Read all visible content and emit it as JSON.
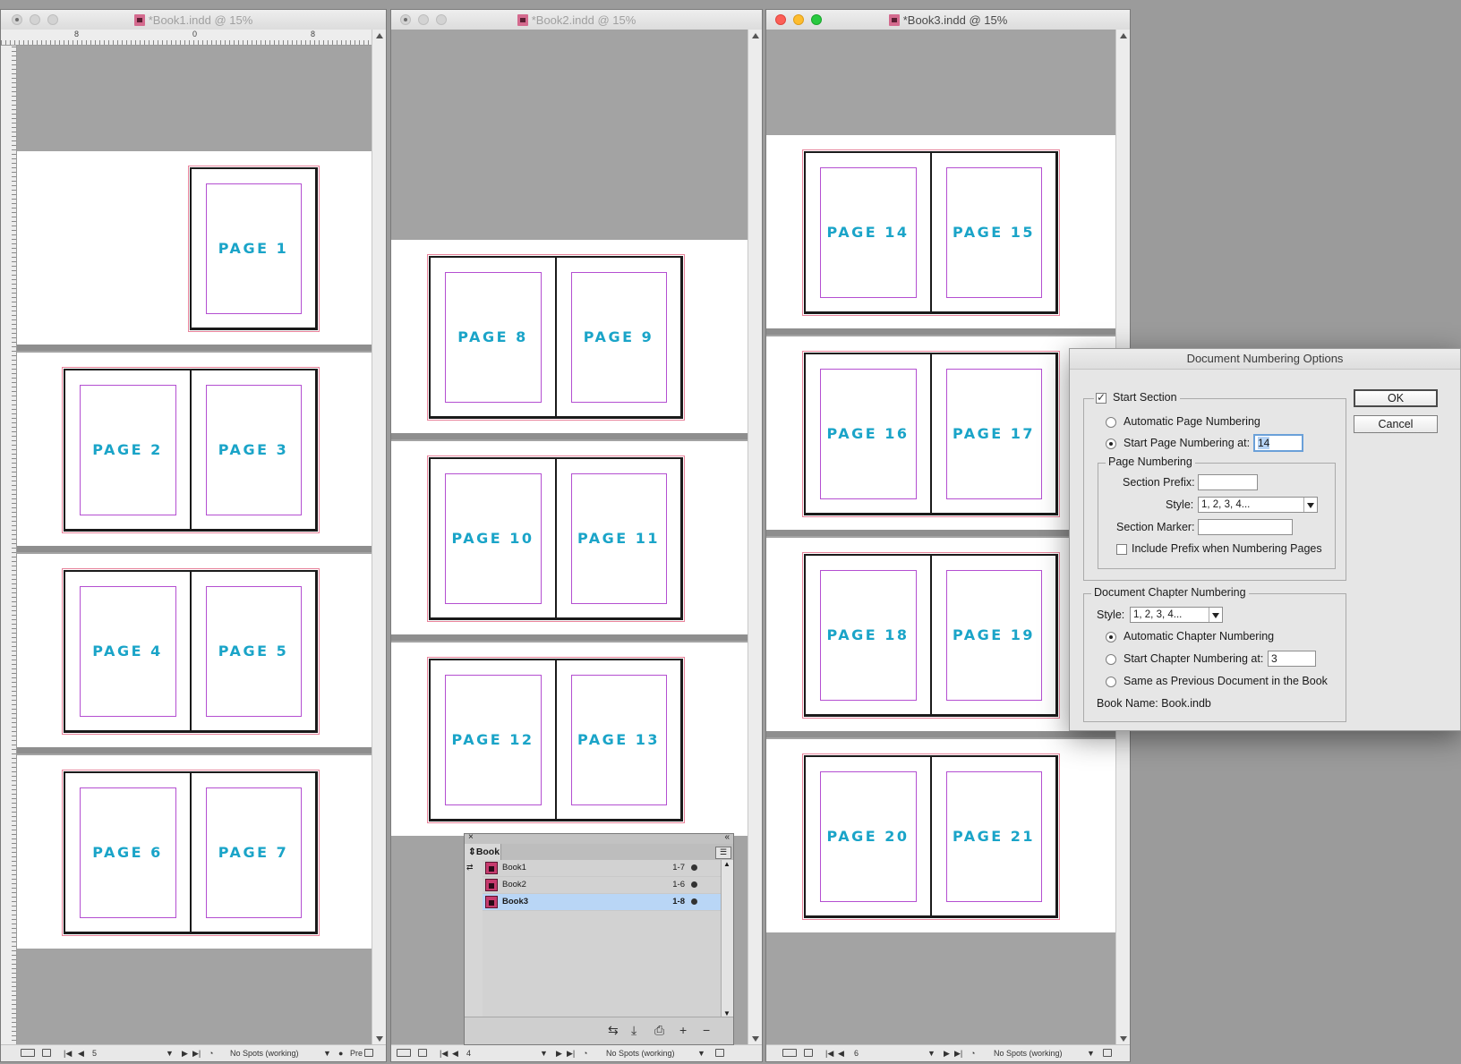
{
  "windows": [
    {
      "title": "*Book1.indd @ 15%",
      "active": false,
      "ruler_labels": [
        "8",
        "0",
        "8"
      ],
      "pages": [
        [
          "PAGE 1"
        ],
        [
          "PAGE 2",
          "PAGE 3"
        ],
        [
          "PAGE 4",
          "PAGE 5"
        ],
        [
          "PAGE 6",
          "PAGE 7"
        ]
      ],
      "status": {
        "page": "5",
        "preflight": "No Spots (working)",
        "extra": "Pre"
      }
    },
    {
      "title": "*Book2.indd @ 15%",
      "active": false,
      "pages": [
        [
          "PAGE 8",
          "PAGE 9"
        ],
        [
          "PAGE 10",
          "PAGE 11"
        ],
        [
          "PAGE 12",
          "PAGE 13"
        ]
      ],
      "status": {
        "page": "4",
        "preflight": "No Spots (working)"
      }
    },
    {
      "title": "*Book3.indd @ 15%",
      "active": true,
      "pages": [
        [
          "PAGE 14",
          "PAGE 15"
        ],
        [
          "PAGE 16",
          "PAGE 17"
        ],
        [
          "PAGE 18",
          "PAGE 19"
        ],
        [
          "PAGE 20",
          "PAGE 21"
        ]
      ],
      "status": {
        "page": "6",
        "preflight": "No Spots (working)"
      }
    }
  ],
  "book_panel": {
    "tab": "Book",
    "rows": [
      {
        "name": "Book1",
        "pages": "1-7",
        "selected": false
      },
      {
        "name": "Book2",
        "pages": "1-6",
        "selected": false
      },
      {
        "name": "Book3",
        "pages": "1-8",
        "selected": true
      }
    ],
    "footer_icons": [
      "sync-icon",
      "save-icon",
      "print-icon",
      "add-icon",
      "remove-icon"
    ]
  },
  "dialog": {
    "title": "Document Numbering Options",
    "ok": "OK",
    "cancel": "Cancel",
    "start_section": {
      "label": "Start Section",
      "checked": true
    },
    "automatic_page_numbering": {
      "label": "Automatic Page Numbering",
      "selected": false
    },
    "start_page_numbering": {
      "label": "Start Page Numbering at:",
      "selected": true,
      "value": "14"
    },
    "page_numbering": {
      "group_label": "Page Numbering",
      "section_prefix_label": "Section Prefix:",
      "section_prefix_value": "",
      "style_label": "Style:",
      "style_value": "1, 2, 3, 4...",
      "section_marker_label": "Section Marker:",
      "section_marker_value": "",
      "include_prefix": {
        "label": "Include Prefix when Numbering Pages",
        "checked": false
      }
    },
    "chapter": {
      "group_label": "Document Chapter Numbering",
      "style_label": "Style:",
      "style_value": "1, 2, 3, 4...",
      "automatic": {
        "label": "Automatic Chapter Numbering",
        "selected": true
      },
      "start": {
        "label": "Start Chapter Numbering at:",
        "selected": false,
        "value": "3"
      },
      "same_as_previous": {
        "label": "Same as Previous Document in the Book",
        "selected": false
      },
      "book_name": "Book Name: Book.indb"
    }
  },
  "colors": {
    "page_label": "#1aa4c8",
    "margin": "#b44fd1",
    "bleed": "#e8839b",
    "selection": "#b9d6f6"
  }
}
